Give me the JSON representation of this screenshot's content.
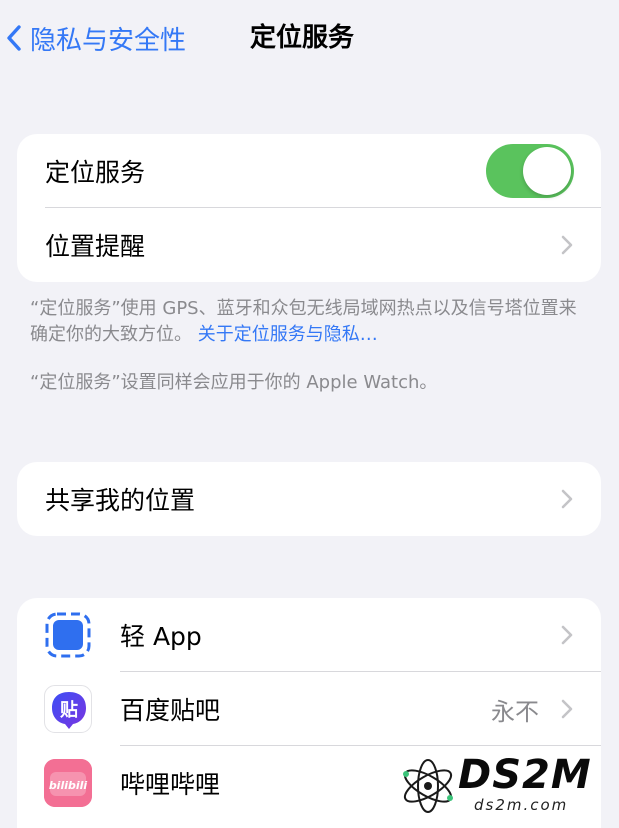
{
  "nav": {
    "back_label": "隐私与安全性",
    "title": "定位服务"
  },
  "location_group": {
    "location_services_label": "定位服务",
    "location_services_on": true,
    "location_alerts_label": "位置提醒"
  },
  "footnotes": {
    "description": "“定位服务”使用 GPS、蓝牙和众包无线局域网热点以及信号塔位置来确定你的大致方位。",
    "about_link": "关于定位服务与隐私…",
    "watch_note": "“定位服务”设置同样会应用于你的 Apple Watch。"
  },
  "share_group": {
    "share_label": "共享我的位置"
  },
  "apps": [
    {
      "name": "轻 App",
      "icon": "app-clip-icon",
      "value": ""
    },
    {
      "name": "百度贴吧",
      "icon": "baidu-tieba-icon",
      "icon_text": "贴",
      "value": "永不"
    },
    {
      "name": "哔哩哔哩",
      "icon": "bilibili-icon",
      "icon_text": "bilibili",
      "value": ""
    }
  ],
  "watermark": {
    "brand": "DS2M",
    "site": "ds2m.com"
  },
  "colors": {
    "accent": "#3478f6",
    "toggle_on": "#5ac35d",
    "background": "#f2f2f7"
  }
}
